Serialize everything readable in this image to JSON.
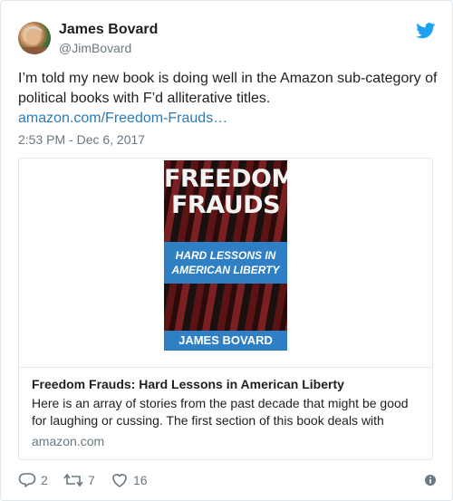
{
  "tweet": {
    "author_name": "James Bovard",
    "author_handle": "@JimBovard",
    "text": "I’m told my new book is doing well in the Amazon sub-category of political books with F’d alliterative titles.",
    "link": "amazon.com/Freedom-Frauds…",
    "timestamp": "2:53 PM - Dec 6, 2017"
  },
  "card": {
    "cover": {
      "title": "FREEDOM FRAUDS",
      "subtitle": "HARD LESSONS IN AMERICAN LIBERTY",
      "author": "JAMES BOVARD"
    },
    "title": "Freedom Frauds: Hard Lessons in American Liberty",
    "description": "Here is an array of stories from the past decade that might be good for laughing or cussing. The first section of this book deals with",
    "domain": "amazon.com"
  },
  "actions": {
    "reply_count": "2",
    "retweet_count": "7",
    "like_count": "16"
  },
  "icons": {
    "bird": "twitter-bird-icon",
    "reply": "reply-icon",
    "retweet": "retweet-icon",
    "like": "heart-icon",
    "info": "info-icon"
  },
  "colors": {
    "link": "#2b7bb9",
    "muted": "#697882",
    "twitter_blue": "#1da1f2",
    "cover_band": "#2f7fc4"
  }
}
